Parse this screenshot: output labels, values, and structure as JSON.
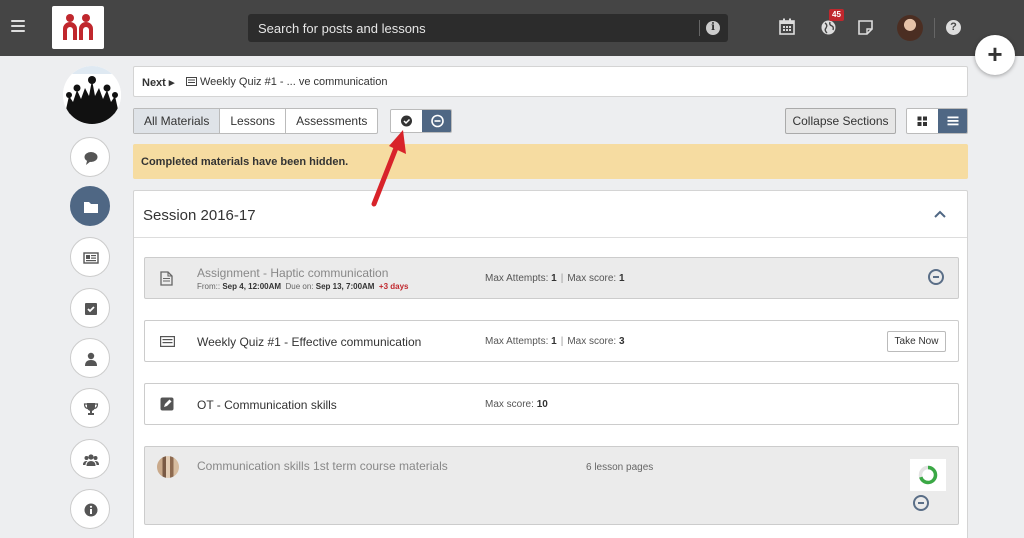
{
  "topbar": {
    "search_placeholder": "Search for posts and lessons",
    "notification_count": "45",
    "info_glyph": "i",
    "help_glyph": "?",
    "fab_glyph": "+"
  },
  "nav": {
    "next_label": "Next",
    "next_title": "Weekly Quiz #1 - ... ve communication"
  },
  "filters": {
    "tabs": [
      "All Materials",
      "Lessons",
      "Assessments"
    ],
    "active_tab": "All Materials",
    "collapse_label": "Collapse Sections"
  },
  "notice": {
    "text": "Completed materials have been hidden."
  },
  "section": {
    "title": "Session 2016-17",
    "items": [
      {
        "title": "Assignment - Haptic communication",
        "from_label": "From::",
        "from_value": "Sep 4, 12:00AM",
        "due_label": "Due on:",
        "due_value": "Sep 13, 7:00AM",
        "late": "+3 days",
        "attempts_label": "Max Attempts:",
        "attempts_value": "1",
        "score_label": "Max score:",
        "score_value": "1",
        "completed": true
      },
      {
        "title": "Weekly Quiz #1 - Effective communication",
        "attempts_label": "Max Attempts:",
        "attempts_value": "1",
        "score_label": "Max score:",
        "score_value": "3",
        "action": "Take Now",
        "completed": false
      },
      {
        "title": "OT - Communication skills",
        "score_label": "Max score:",
        "score_value": "10",
        "completed": false
      },
      {
        "title": "Communication skills 1st term course materials",
        "pages": "6 lesson pages",
        "progress": 0.7,
        "completed": true
      }
    ]
  },
  "colors": {
    "topbar": "#454545",
    "accent": "#4f6784",
    "notice_bg": "#f6dca1",
    "badge": "#c0272d",
    "progress_green": "#3aa845",
    "arrow_red": "#d8232a"
  },
  "icons": [
    "hamburger-icon",
    "logo-icon",
    "info-icon",
    "calendar-icon",
    "globe-icon",
    "note-icon",
    "help-icon",
    "plus-icon",
    "comment-icon",
    "folder-icon",
    "newspaper-icon",
    "checkbox-icon",
    "user-icon",
    "trophy-icon",
    "users-icon",
    "info-circle-icon",
    "check-circle-icon",
    "minus-circle-icon",
    "grid-icon",
    "list-icon",
    "chevron-up-icon",
    "document-icon",
    "quiz-icon",
    "edit-icon"
  ]
}
